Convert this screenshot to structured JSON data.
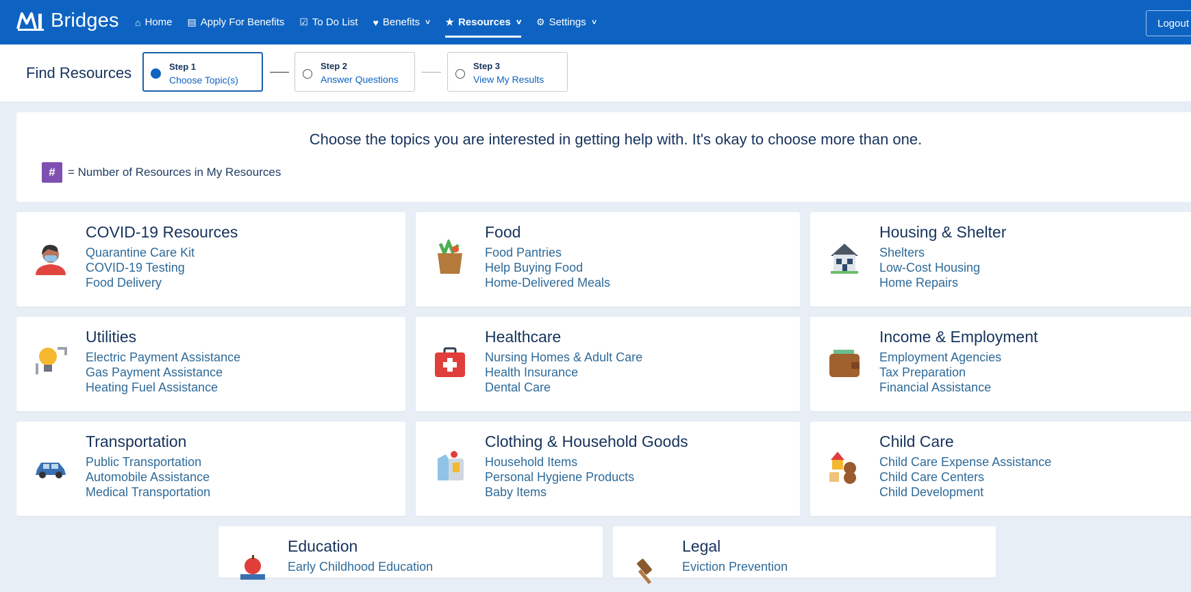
{
  "header": {
    "brand": "Bridges",
    "nav": [
      {
        "label": "Home",
        "icon": "home-icon"
      },
      {
        "label": "Apply For Benefits",
        "icon": "document-icon"
      },
      {
        "label": "To Do List",
        "icon": "checkbox-icon"
      },
      {
        "label": "Benefits",
        "icon": "heart-icon"
      },
      {
        "label": "Resources",
        "icon": "star-icon"
      },
      {
        "label": "Settings",
        "icon": "gear-icon"
      }
    ],
    "logout": "Logout"
  },
  "steps": {
    "title": "Find Resources",
    "items": [
      {
        "label": "Step 1",
        "sub": "Choose Topic(s)"
      },
      {
        "label": "Step 2",
        "sub": "Answer Questions"
      },
      {
        "label": "Step 3",
        "sub": "View My Results"
      }
    ]
  },
  "intro": {
    "text": "Choose the topics you are interested in getting help with. It's okay to choose more than one.",
    "badge": "#",
    "legend": "= Number of Resources in My Resources"
  },
  "topics": [
    {
      "title": "COVID-19 Resources",
      "items": [
        "Quarantine Care Kit",
        "COVID-19 Testing",
        "Food Delivery"
      ],
      "icon": "person-mask-icon"
    },
    {
      "title": "Food",
      "items": [
        "Food Pantries",
        "Help Buying Food",
        "Home-Delivered Meals"
      ],
      "icon": "grocery-bag-icon"
    },
    {
      "title": "Housing & Shelter",
      "items": [
        "Shelters",
        "Low-Cost Housing",
        "Home Repairs"
      ],
      "icon": "house-icon"
    },
    {
      "title": "Utilities",
      "items": [
        "Electric Payment Assistance",
        "Gas Payment Assistance",
        "Heating Fuel Assistance"
      ],
      "icon": "lightbulb-icon"
    },
    {
      "title": "Healthcare",
      "items": [
        "Nursing Homes & Adult Care",
        "Health Insurance",
        "Dental Care"
      ],
      "icon": "first-aid-kit-icon"
    },
    {
      "title": "Income & Employment",
      "items": [
        "Employment Agencies",
        "Tax Preparation",
        "Financial Assistance"
      ],
      "icon": "wallet-icon"
    },
    {
      "title": "Transportation",
      "items": [
        "Public Transportation",
        "Automobile Assistance",
        "Medical Transportation"
      ],
      "icon": "car-icon"
    },
    {
      "title": "Clothing & Household Goods",
      "items": [
        "Household Items",
        "Personal Hygiene Products",
        "Baby Items"
      ],
      "icon": "clothing-icon"
    },
    {
      "title": "Child Care",
      "items": [
        "Child Care Expense Assistance",
        "Child Care Centers",
        "Child Development"
      ],
      "icon": "blocks-teddy-icon"
    },
    {
      "title": "Education",
      "items": [
        "Early Childhood Education"
      ],
      "icon": "apple-books-icon"
    },
    {
      "title": "Legal",
      "items": [
        "Eviction Prevention"
      ],
      "icon": "gavel-icon"
    }
  ]
}
